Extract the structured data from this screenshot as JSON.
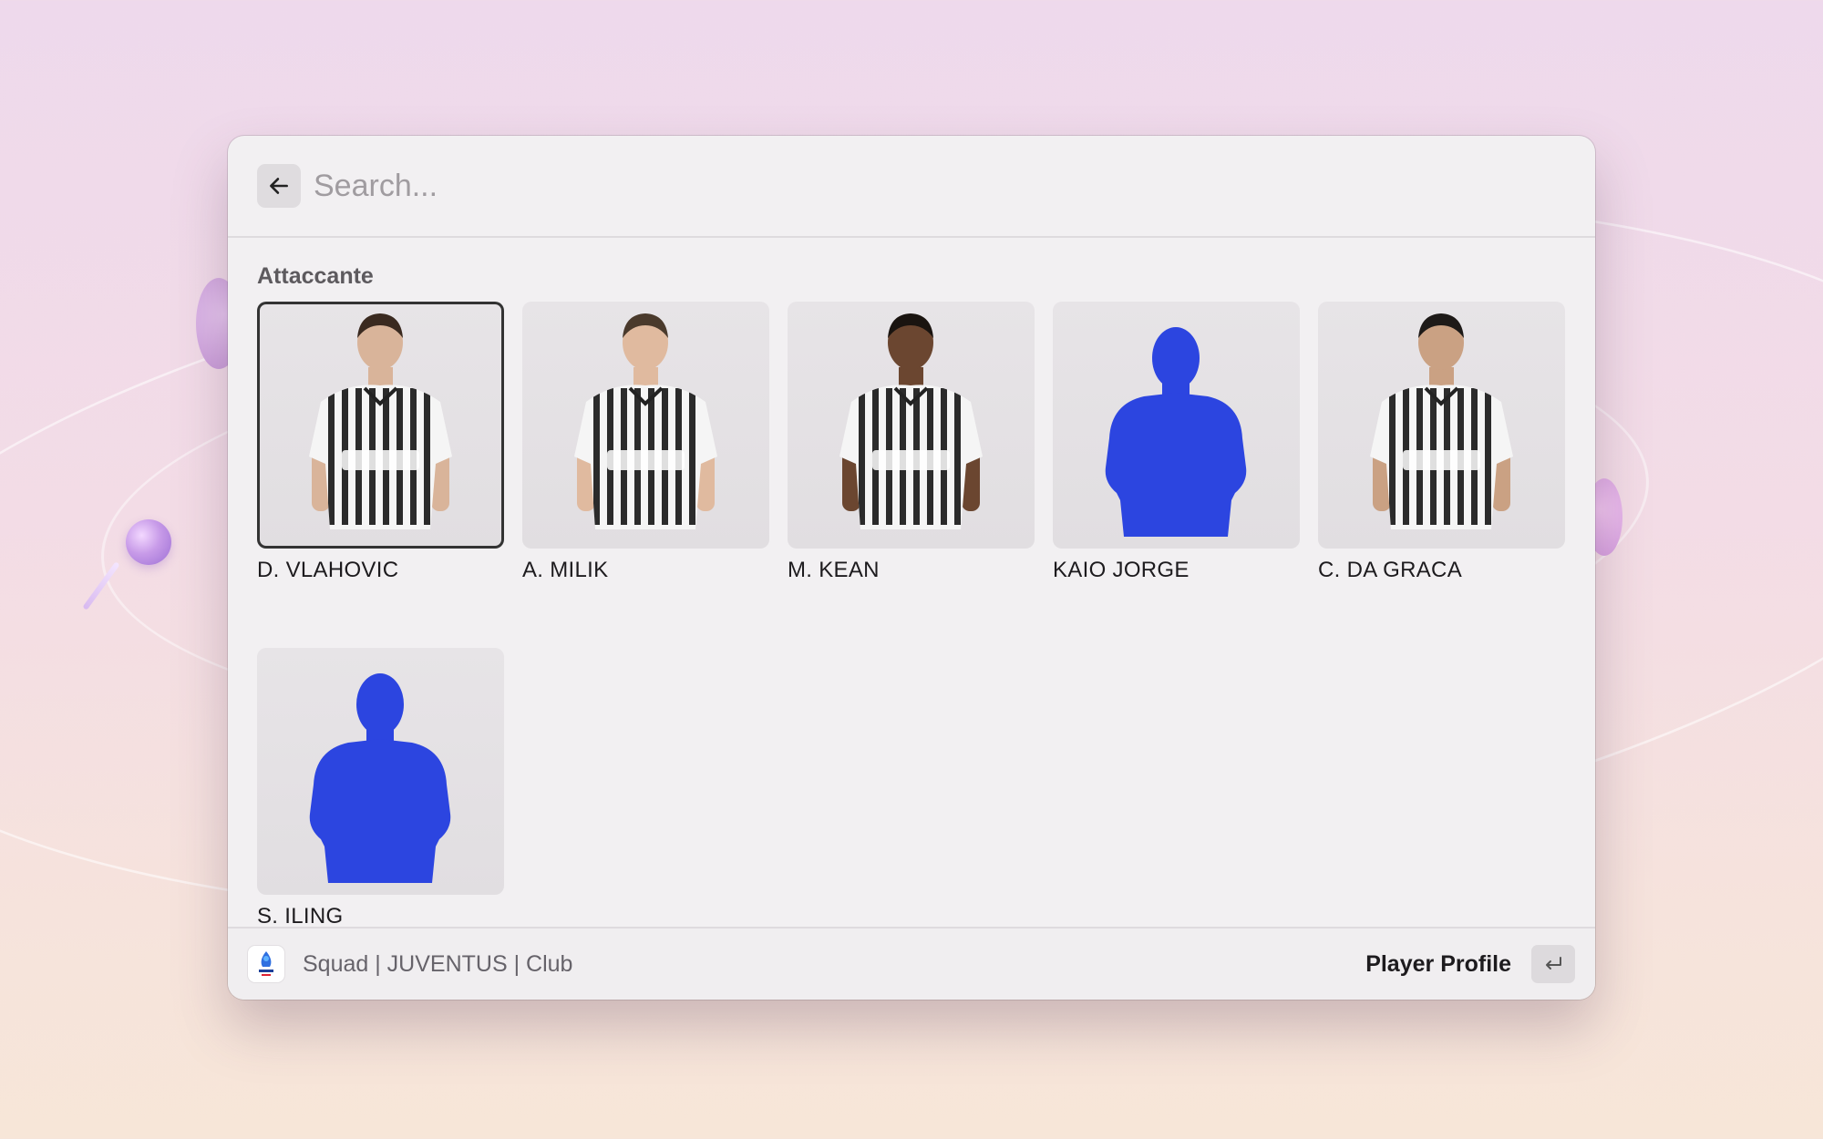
{
  "search": {
    "placeholder": "Search..."
  },
  "section": {
    "title": "Attaccante"
  },
  "players": [
    {
      "name": "D. VLAHOVIC",
      "has_photo": true,
      "selected": true
    },
    {
      "name": "A. MILIK",
      "has_photo": true,
      "selected": false
    },
    {
      "name": "M. KEAN",
      "has_photo": true,
      "selected": false
    },
    {
      "name": "KAIO JORGE",
      "has_photo": false,
      "selected": false
    },
    {
      "name": "C. DA GRACA",
      "has_photo": true,
      "selected": false
    },
    {
      "name": "S. ILING",
      "has_photo": false,
      "selected": false
    }
  ],
  "footer": {
    "breadcrumb": "Squad | JUVENTUS | Club",
    "action": "Player Profile",
    "logo_icon": "serie-a-logo",
    "enter_icon": "return-key-icon"
  },
  "colors": {
    "silhouette": "#2c45e0",
    "jersey_stripe": "#2b2b2b",
    "jersey_white": "#f5f5f5"
  }
}
